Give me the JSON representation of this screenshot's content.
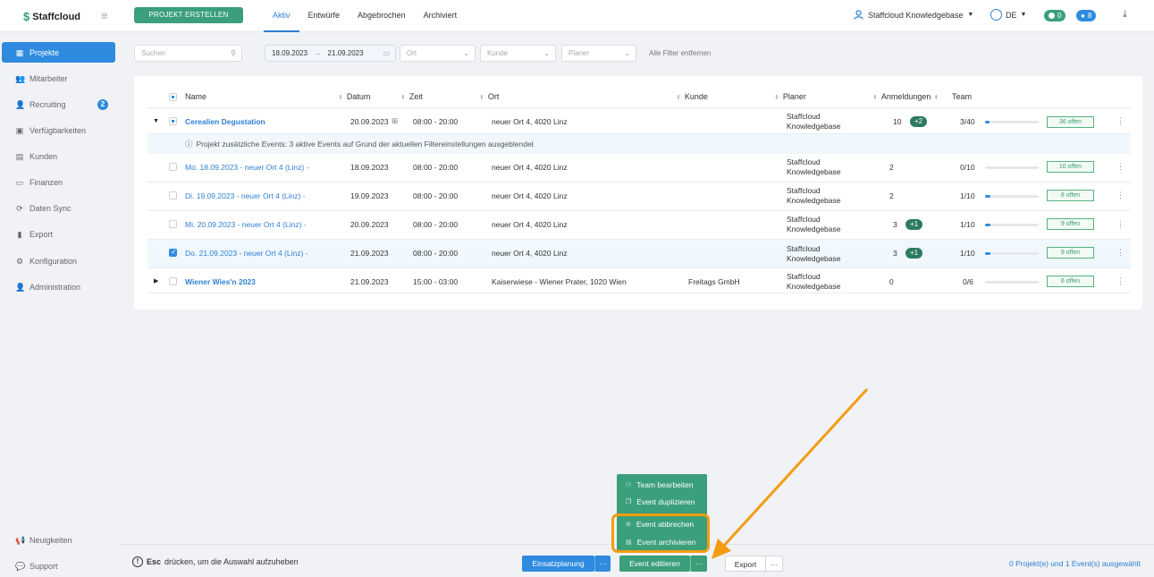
{
  "app": {
    "name": "Staffcloud",
    "create_button": "PROJEKT ERSTELLEN"
  },
  "tabs": [
    "Aktiv",
    "Entwürfe",
    "Abgebrochen",
    "Archiviert"
  ],
  "header": {
    "user": "Staffcloud Knowledgebase",
    "lang": "DE",
    "pill_green": "0",
    "pill_blue": "8"
  },
  "sidebar": {
    "items": [
      {
        "label": "Projekte",
        "icon": "sitemap-icon"
      },
      {
        "label": "Mitarbeiter",
        "icon": "users-icon"
      },
      {
        "label": "Recruiting",
        "icon": "user-plus-icon",
        "badge": "2"
      },
      {
        "label": "Verfügbarkeiten",
        "icon": "calendar-check-icon"
      },
      {
        "label": "Kunden",
        "icon": "building-icon"
      },
      {
        "label": "Finanzen",
        "icon": "money-icon"
      },
      {
        "label": "Daten Sync",
        "icon": "sync-icon"
      },
      {
        "label": "Export",
        "icon": "file-icon"
      },
      {
        "label": "Konfiguration",
        "icon": "gear-icon"
      },
      {
        "label": "Administration",
        "icon": "user-cog-icon"
      }
    ],
    "bottom": [
      {
        "label": "Neuigkeiten",
        "icon": "megaphone-icon"
      },
      {
        "label": "Support",
        "icon": "chat-icon"
      }
    ]
  },
  "filters": {
    "search_placeholder": "Suchen",
    "date_from": "18.09.2023",
    "date_to": "21.09.2023",
    "date_sep": "→",
    "ort": "Ort",
    "kunde": "Kunde",
    "planer": "Planer",
    "clear": "Alle Filter entfernen"
  },
  "table": {
    "headers": [
      "Name",
      "Datum",
      "Zeit",
      "Ort",
      "Kunde",
      "Planer",
      "Anmeldungen",
      "Team"
    ],
    "info_text": "Projekt zusätzliche Events:  3 aktive Events auf Grund der aktuellen Filtereinstellungen ausgeblendet",
    "rows": [
      {
        "name": "Cerealien Degustation",
        "datum": "20.09.2023",
        "zeit": "08:00 - 20:00",
        "ort": "neuer Ort 4, 4020 Linz",
        "kunde": "",
        "planer1": "Staffcloud",
        "planer2": "Knowledgebase",
        "anm": "10",
        "plus": "+2",
        "team": "3/40",
        "team_fill": 0.075,
        "offen": "36 offen"
      },
      {
        "name": "Mo. 18.09.2023 - neuer Ort 4 (Linz) -",
        "datum": "18.09.2023",
        "zeit": "08:00 - 20:00",
        "ort": "neuer Ort 4, 4020 Linz",
        "kunde": "",
        "planer1": "Staffcloud",
        "planer2": "Knowledgebase",
        "anm": "2",
        "plus": "",
        "team": "0/10",
        "team_fill": 0,
        "offen": "10 offen"
      },
      {
        "name": "Di. 19.09.2023 - neuer Ort 4 (Linz) -",
        "datum": "19.09.2023",
        "zeit": "08:00 - 20:00",
        "ort": "neuer Ort 4, 4020 Linz",
        "kunde": "",
        "planer1": "Staffcloud",
        "planer2": "Knowledgebase",
        "anm": "2",
        "plus": "",
        "team": "1/10",
        "team_fill": 0.1,
        "offen": "8 offen"
      },
      {
        "name": "Mi. 20.09.2023 - neuer Ort 4 (Linz) -",
        "datum": "20.09.2023",
        "zeit": "08:00 - 20:00",
        "ort": "neuer Ort 4, 4020 Linz",
        "kunde": "",
        "planer1": "Staffcloud",
        "planer2": "Knowledgebase",
        "anm": "3",
        "plus": "+1",
        "team": "1/10",
        "team_fill": 0.1,
        "offen": "9 offen"
      },
      {
        "name": "Do. 21.09.2023 - neuer Ort 4 (Linz) -",
        "datum": "21.09.2023",
        "zeit": "08:00 - 20:00",
        "ort": "neuer Ort 4, 4020 Linz",
        "kunde": "",
        "planer1": "Staffcloud",
        "planer2": "Knowledgebase",
        "anm": "3",
        "plus": "+1",
        "team": "1/10",
        "team_fill": 0.1,
        "offen": "9 offen"
      },
      {
        "name": "Wiener Wies'n 2023",
        "datum": "21.09.2023",
        "zeit": "15:00 - 03:00",
        "ort": "Kaiserwiese - Wiener Prater, 1020 Wien",
        "kunde": "Freitags GmbH",
        "planer1": "Staffcloud",
        "planer2": "Knowledgebase",
        "anm": "0",
        "plus": "",
        "team": "0/6",
        "team_fill": 0,
        "offen": "6 offen"
      }
    ]
  },
  "context_menu": {
    "items": [
      "Team bearbeiten",
      "Event duplizieren",
      "Event abbrechen",
      "Event archivieren"
    ]
  },
  "bottom": {
    "esc_key": "Esc",
    "esc_text": "drücken, um die Auswahl aufzuheben",
    "einsatzplanung": "Einsatzplanung",
    "event_edit": "Event editieren",
    "export": "Export",
    "more": "···",
    "selection": "0 Projekt(e) und 1 Event(s) ausgewählt"
  },
  "colors": {
    "accent": "#2f8be0",
    "green": "#3a9f7a",
    "highlight": "#f39c12"
  }
}
